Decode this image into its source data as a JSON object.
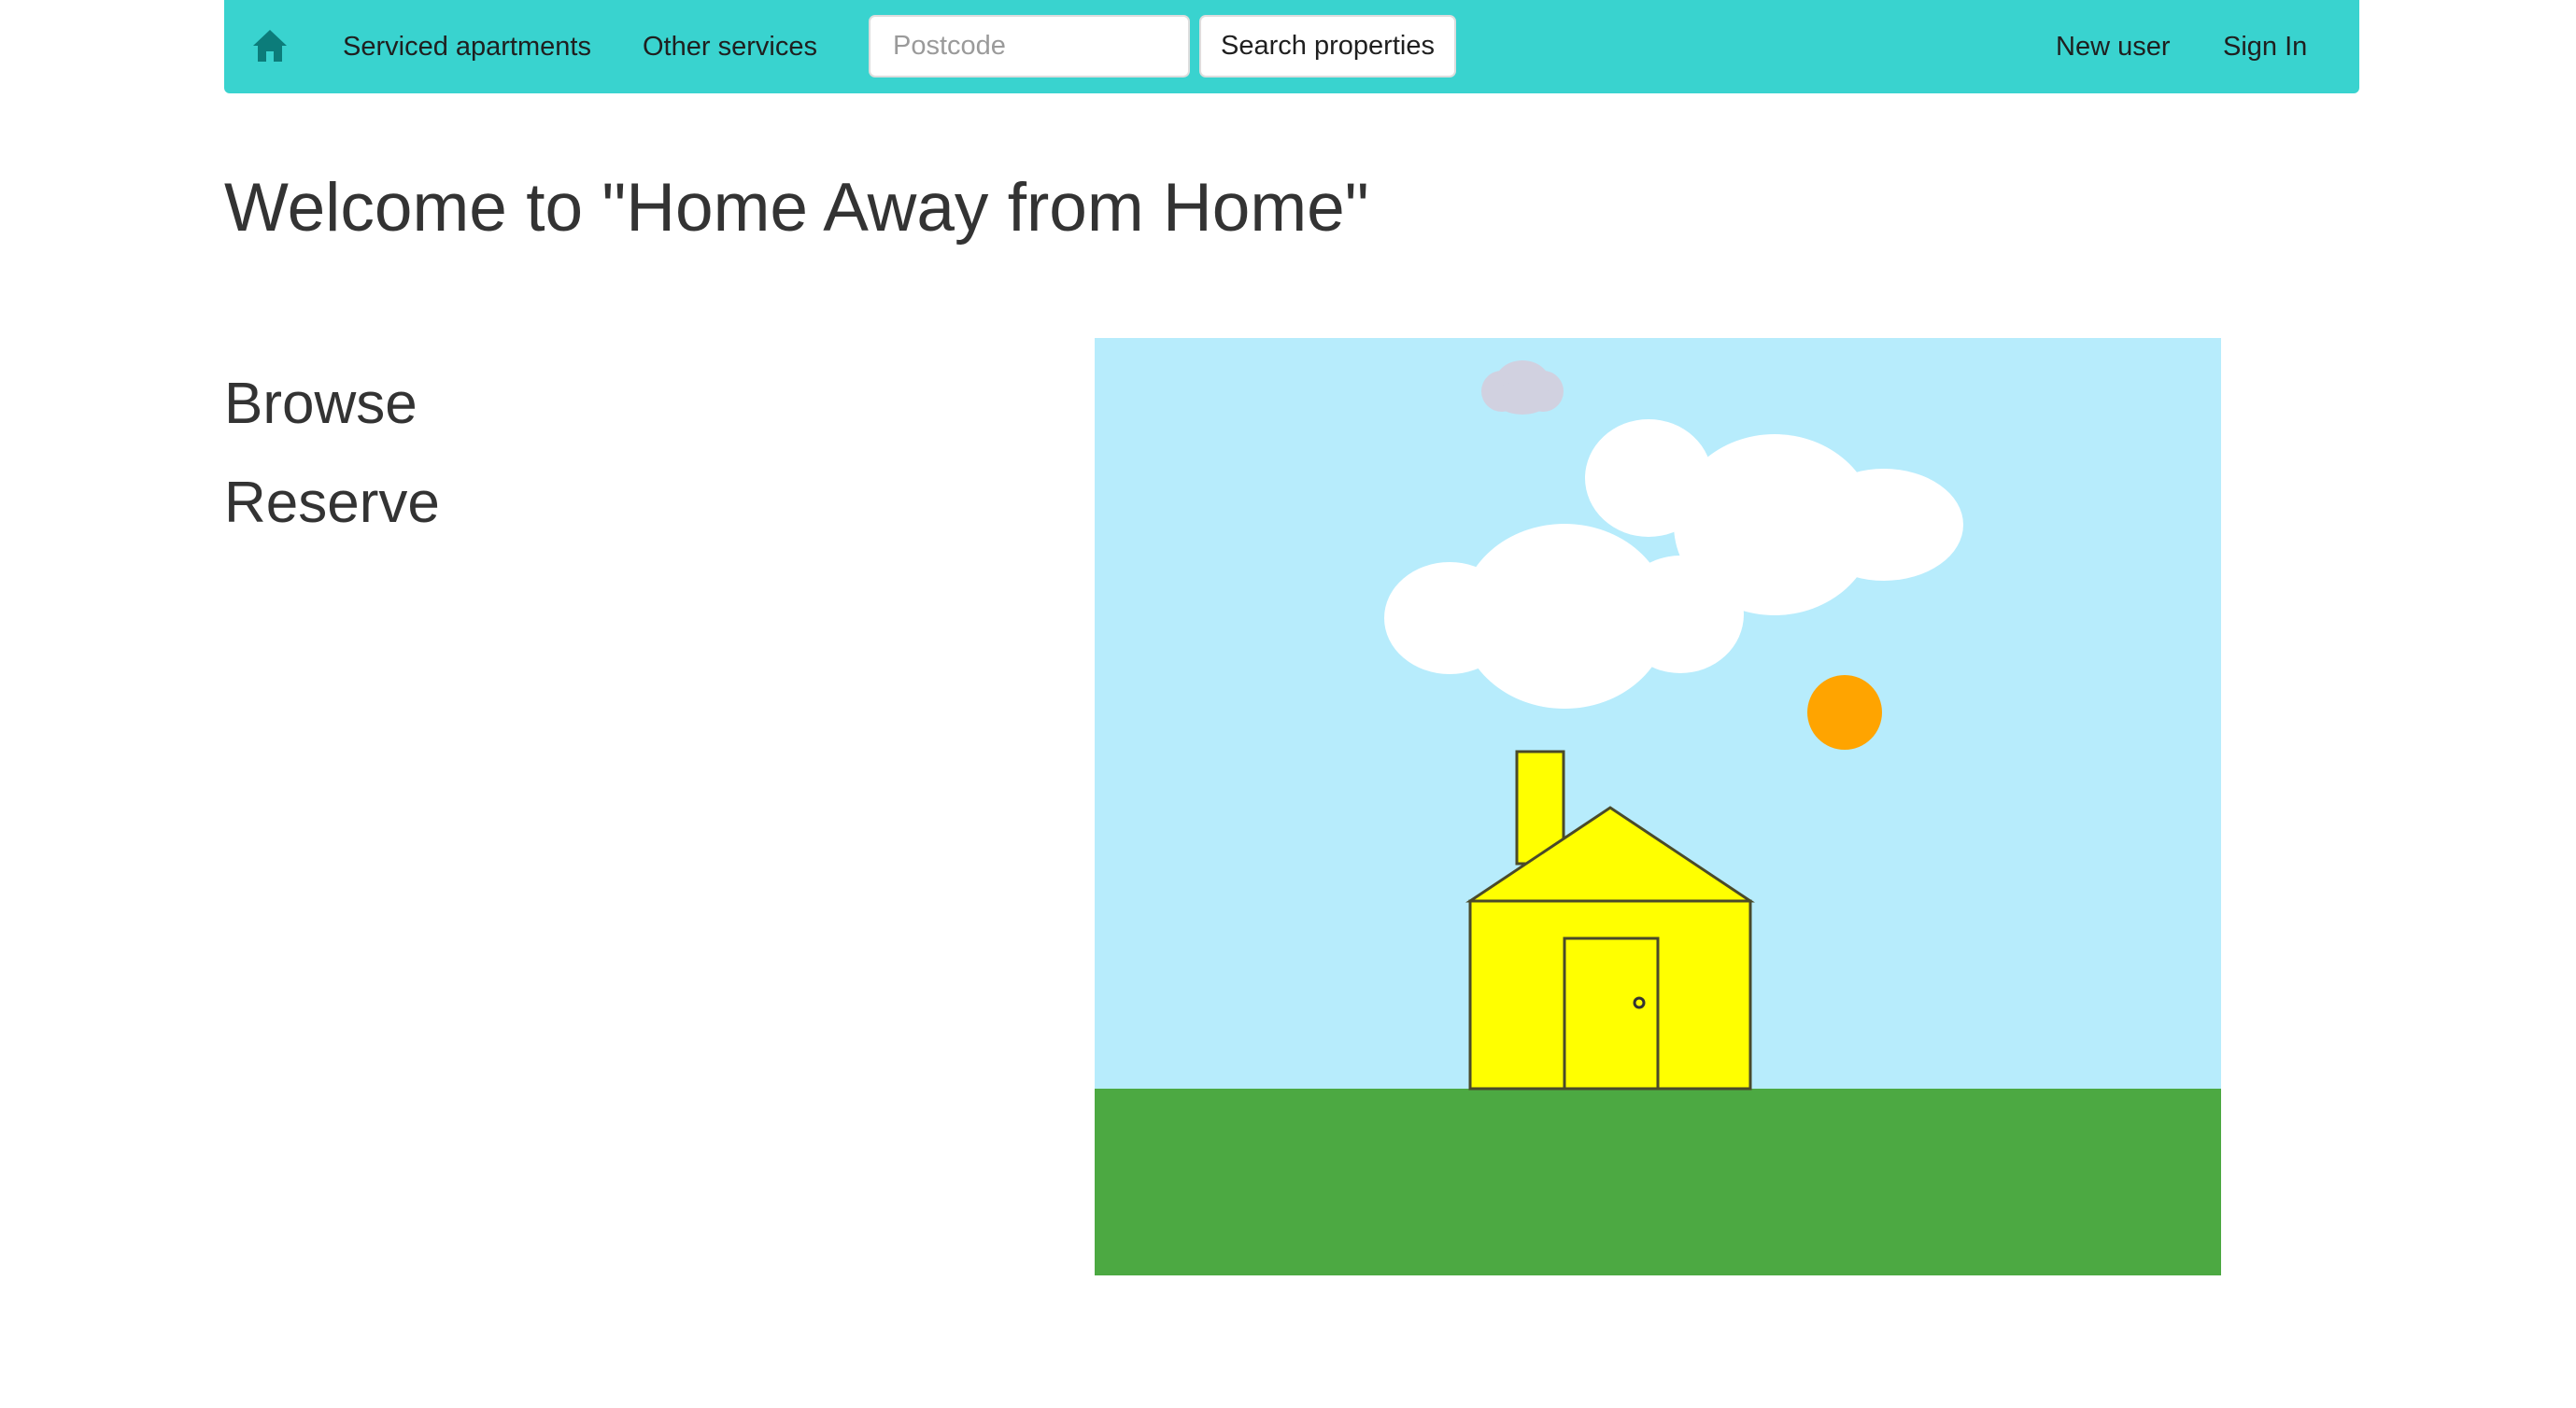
{
  "navbar": {
    "home_icon": "home-icon",
    "links": {
      "serviced_apartments": "Serviced apartments",
      "other_services": "Other services",
      "new_user": "New user",
      "sign_in": "Sign In"
    },
    "search": {
      "placeholder": "Postcode",
      "value": "",
      "button_label": "Search properties"
    },
    "background_color": "#39d3cf"
  },
  "main": {
    "title": "Welcome to \"Home Away from Home\"",
    "sections": {
      "browse": "Browse",
      "reserve": "Reserve"
    }
  },
  "illustration": {
    "sky_color": "#b7ecfc",
    "grass_color": "#4ca942",
    "house_color": "#ffff00",
    "sun_color": "#ffa400",
    "cloud_color": "#ffffff",
    "small_cloud_color": "#d1d1e0"
  }
}
